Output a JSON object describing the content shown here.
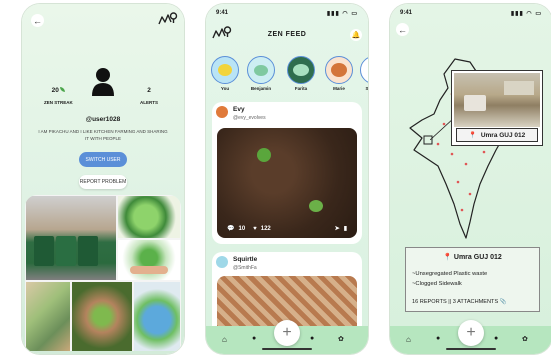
{
  "profile": {
    "streak_value": "20",
    "streak_label": "ZEN STREAK",
    "alerts_value": "2",
    "alerts_label": "ALERTS",
    "username": "@user1028",
    "bio": "I AM PIKACHU AND I LIKE KITCHEN FARMING AND SHARING IT WITH PEOPLE",
    "switch_user_label": "SWITCH USER",
    "report_problem_label": "REPORT PROBLEM"
  },
  "feed": {
    "time": "9:41",
    "title": "ZEN FEED",
    "stories": [
      {
        "name": "You"
      },
      {
        "name": "Benjamin"
      },
      {
        "name": "Farita"
      },
      {
        "name": "Marie"
      },
      {
        "name": "S"
      }
    ],
    "posts": [
      {
        "name": "Evy",
        "handle": "@evy_evolves",
        "comments": "10",
        "likes": "122"
      },
      {
        "name": "Squirtle",
        "handle": "@SmithFa"
      }
    ]
  },
  "report": {
    "time": "9:41",
    "location_label": "Umra GUJ 012",
    "card_title": "Umra GUJ 012",
    "issues": [
      "~Unsegregated Plastic waste",
      "~Clogged Sidewalk"
    ],
    "footer": "16 REPORTS || 3 ATTACHMENTS"
  },
  "icons": {
    "back": "back-arrow-icon",
    "map": "map-pin-icon",
    "plus": "plus-icon"
  },
  "colors": {
    "accent": "#5b8fd8",
    "nav_bar": "#b6e6bf",
    "background": "#e6f6ea"
  }
}
